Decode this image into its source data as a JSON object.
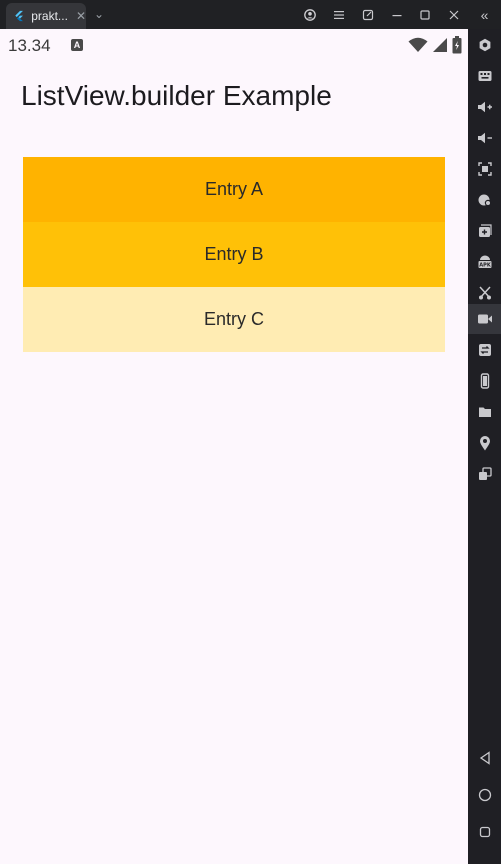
{
  "window": {
    "tab_title": "prakt...",
    "tab_close": "✕",
    "tab_dropdown": "⌄",
    "controls": [
      "account-icon",
      "menu-icon",
      "pop-out-icon",
      "minimize-icon",
      "maximize-icon",
      "close-icon"
    ],
    "collapse_label": "«"
  },
  "statusbar": {
    "time": "13.34",
    "badge": "A",
    "icons": [
      "wifi-icon",
      "signal-icon",
      "battery-icon"
    ]
  },
  "app": {
    "title": "ListView.builder Example",
    "entries": [
      {
        "label": "Entry A",
        "color": "#ffb300"
      },
      {
        "label": "Entry B",
        "color": "#ffc107"
      },
      {
        "label": "Entry C",
        "color": "#ffecb3"
      }
    ]
  },
  "sidepanel": {
    "tools": [
      "settings-icon",
      "keyboard-icon",
      "volume-up-icon",
      "volume-down-icon",
      "screenshot-icon",
      "rotate-icon",
      "multi-instance-icon",
      "apk-install-icon",
      "shake-icon",
      "screen-record-icon",
      "sync-icon",
      "phone-rotate-icon",
      "folder-icon",
      "location-icon",
      "multi-window-icon"
    ],
    "nav": [
      "back-icon",
      "home-icon",
      "recents-icon"
    ]
  },
  "colors": {
    "screen_bg": "#fdf7fd",
    "chrome_bg": "#1f1f24",
    "accent": "#ffb300"
  }
}
